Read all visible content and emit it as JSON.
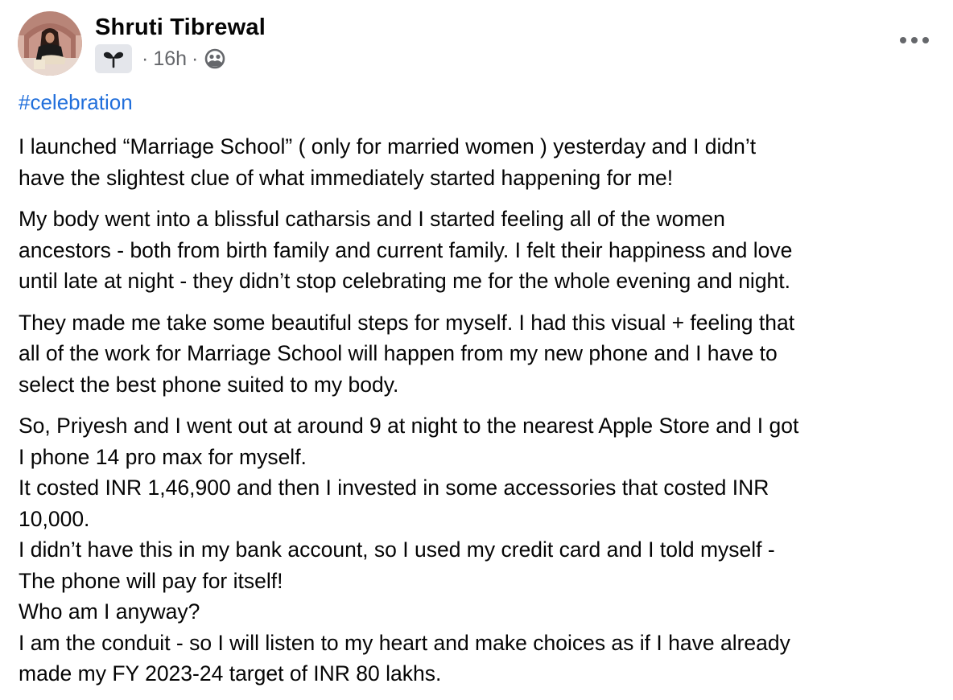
{
  "post": {
    "author": "Shruti Tibrewal",
    "time": "16h",
    "separator": "·",
    "badge_icon": "sprout-icon",
    "audience_icon": "friends-globe-icon",
    "more_icon": "ellipsis-icon",
    "hashtag": "#celebration",
    "paragraphs": [
      "I launched “Marriage School” ( only for married women ) yesterday and I didn’t\nhave the slightest clue of what immediately started happening for me!",
      "My body went into a blissful catharsis and I started feeling all of the women\nancestors - both from birth family and current family. I felt their happiness and love\nuntil late at night - they didn’t stop celebrating me for the whole evening and night.",
      "They made me take some beautiful steps for myself. I had this visual + feeling that\nall of the work for Marriage School will happen from my new phone and I have to\nselect the best phone suited to my body.",
      "So, Priyesh and I went out at around 9 at night to the nearest Apple Store and I got\nI phone 14 pro max for myself.\nIt costed INR 1,46,900 and then I invested in some accessories that costed INR\n10,000.\nI didn’t have this in my bank account, so I used my credit card and I told myself -\nThe phone will pay for itself!\nWho am I anyway?\nI am the conduit - so I will listen to my heart and make choices as if I have already\nmade my FY 2023-24 target of INR 80 lakhs."
    ]
  },
  "colors": {
    "text": "#050505",
    "secondary": "#65676b",
    "link": "#216fdb",
    "badge_bg": "#e4e6eb"
  }
}
